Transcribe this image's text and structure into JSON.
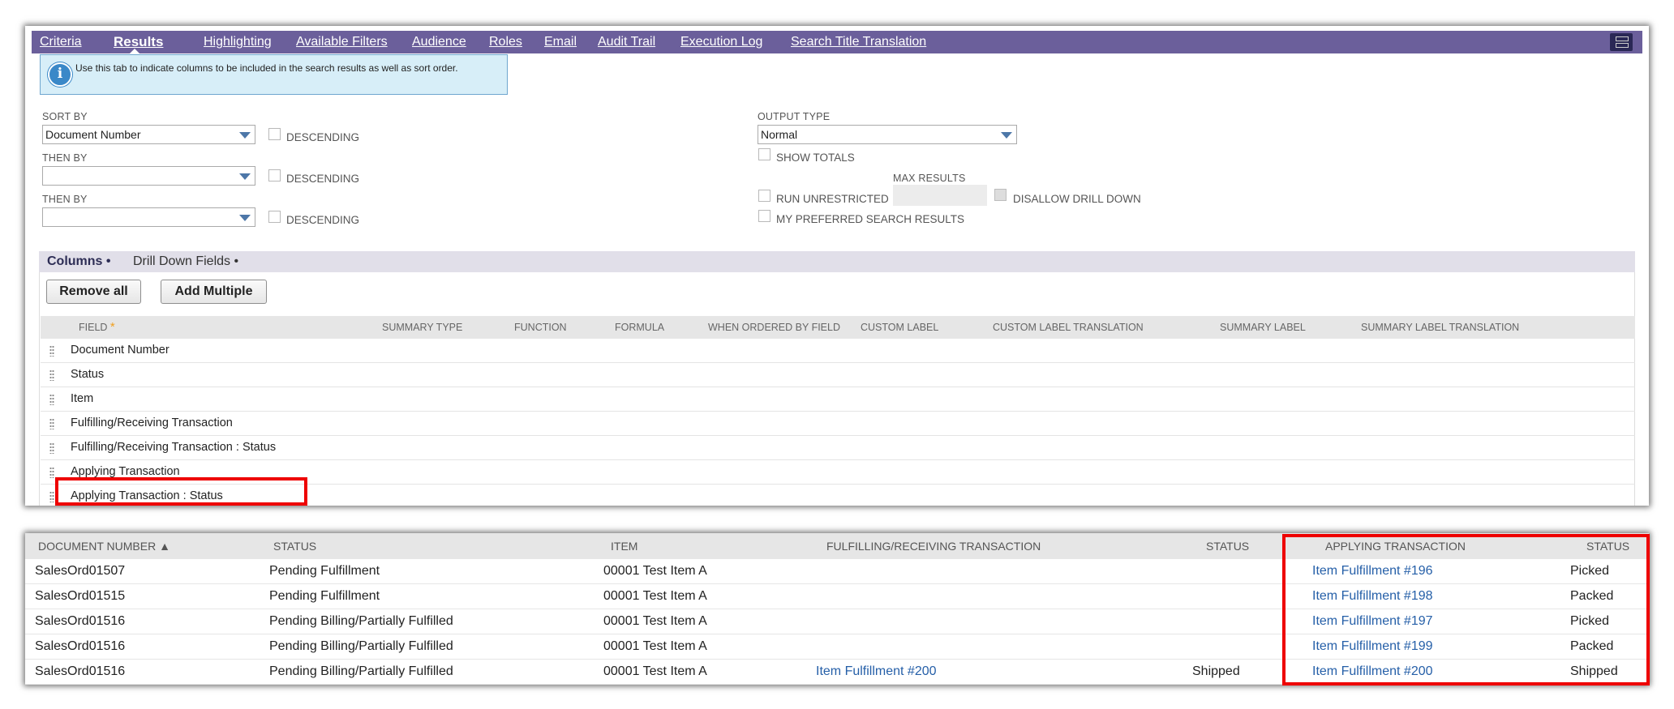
{
  "subtabs": [
    {
      "label": "Criteria",
      "active": false
    },
    {
      "label": "Results",
      "active": true
    },
    {
      "label": "Highlighting",
      "active": false
    },
    {
      "label": "Available Filters",
      "active": false
    },
    {
      "label": "Audience",
      "active": false
    },
    {
      "label": "Roles",
      "active": false
    },
    {
      "label": "Email",
      "active": false
    },
    {
      "label": "Audit Trail",
      "active": false
    },
    {
      "label": "Execution Log",
      "active": false
    },
    {
      "label": "Search Title Translation",
      "active": false
    }
  ],
  "info": {
    "text": "Use this tab to indicate columns to be included in the search results as well as sort order."
  },
  "sort": {
    "sort_by_label": "SORT BY",
    "sort_by_value": "Document Number",
    "then_by_label": "THEN BY",
    "then_by_1_value": "",
    "then_by_2_value": "",
    "descending_label": "DESCENDING"
  },
  "output": {
    "output_type_label": "OUTPUT TYPE",
    "output_type_value": "Normal",
    "show_totals_label": "SHOW TOTALS",
    "max_results_label": "MAX RESULTS",
    "run_unrestricted_label": "RUN UNRESTRICTED",
    "disallow_drill_down_label": "DISALLOW DRILL DOWN",
    "preferred_label": "MY PREFERRED SEARCH RESULTS"
  },
  "column_tabs": [
    {
      "label": "Columns •",
      "active": true
    },
    {
      "label": "Drill Down Fields •",
      "active": false
    }
  ],
  "buttons": {
    "remove_all": "Remove all",
    "add_multiple": "Add Multiple"
  },
  "grid": {
    "headers": {
      "field": "FIELD",
      "required": "*",
      "summary_type": "SUMMARY TYPE",
      "function": "FUNCTION",
      "formula": "FORMULA",
      "when_ordered": "WHEN ORDERED BY FIELD",
      "custom_label": "CUSTOM LABEL",
      "custom_label_translation": "CUSTOM LABEL TRANSLATION",
      "summary_label": "SUMMARY LABEL",
      "summary_label_translation": "SUMMARY LABEL TRANSLATION"
    },
    "rows": [
      "Document Number",
      "Status",
      "Item",
      "Fulfilling/Receiving Transaction",
      "Fulfilling/Receiving Transaction : Status",
      "Applying Transaction",
      "Applying Transaction : Status"
    ]
  },
  "results": {
    "headers": {
      "doc_number": "DOCUMENT NUMBER ▲",
      "status": "STATUS",
      "item": "ITEM",
      "fulfilling": "FULFILLING/RECEIVING TRANSACTION",
      "fulfilling_status": "STATUS",
      "applying": "APPLYING TRANSACTION",
      "applying_status": "STATUS"
    },
    "rows": [
      {
        "doc": "SalesOrd01507",
        "status": "Pending Fulfillment",
        "item": "00001 Test Item A",
        "fulfilling": "",
        "fulfilling_status": "",
        "applying": "Item Fulfillment #196",
        "applying_status": "Picked"
      },
      {
        "doc": "SalesOrd01515",
        "status": "Pending Fulfillment",
        "item": "00001 Test Item A",
        "fulfilling": "",
        "fulfilling_status": "",
        "applying": "Item Fulfillment #198",
        "applying_status": "Packed"
      },
      {
        "doc": "SalesOrd01516",
        "status": "Pending Billing/Partially Fulfilled",
        "item": "00001 Test Item A",
        "fulfilling": "",
        "fulfilling_status": "",
        "applying": "Item Fulfillment #197",
        "applying_status": "Picked"
      },
      {
        "doc": "SalesOrd01516",
        "status": "Pending Billing/Partially Fulfilled",
        "item": "00001 Test Item A",
        "fulfilling": "",
        "fulfilling_status": "",
        "applying": "Item Fulfillment #199",
        "applying_status": "Packed"
      },
      {
        "doc": "SalesOrd01516",
        "status": "Pending Billing/Partially Fulfilled",
        "item": "00001 Test Item A",
        "fulfilling": "Item Fulfillment #200",
        "fulfilling_status": "Shipped",
        "applying": "Item Fulfillment #200",
        "applying_status": "Shipped"
      }
    ]
  },
  "colors": {
    "tab_bar": "#6b5f9b",
    "info_bg": "#d7eef8",
    "link": "#255fa8",
    "highlight": "#ee0000"
  }
}
